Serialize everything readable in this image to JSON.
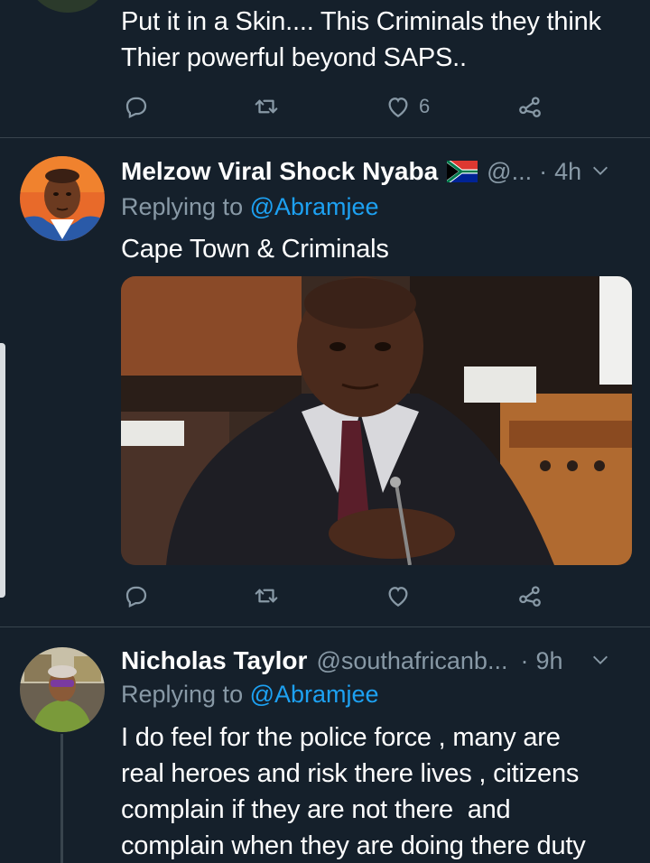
{
  "tweets": [
    {
      "text_lines": [
        "Put it in a Skin.... This Criminals they think",
        "Thier powerful beyond SAPS.."
      ],
      "actions": {
        "like_count": "6"
      }
    },
    {
      "name": "Melzow Viral Shock Nyaba",
      "handle": "@...",
      "time": "4h",
      "replying_prefix": "Replying to ",
      "replying_to": "@Abramjee",
      "text_lines": [
        "Cape Town & Criminals"
      ],
      "actions": {
        "like_count": ""
      }
    },
    {
      "name": "Nicholas Taylor",
      "handle": "@southafricanb...",
      "time": "9h",
      "replying_prefix": "Replying to ",
      "replying_to": "@Abramjee",
      "text_lines": [
        "I do feel for the police force , many are",
        "real heroes and risk there lives , citizens",
        "complain if they are not there  and",
        "complain when they are doing there duty"
      ]
    }
  ],
  "separator": "·",
  "colors": {
    "background": "#15202b",
    "divider": "#38444d",
    "secondary_text": "#8899a6",
    "link": "#1da1f2"
  },
  "icons": [
    "reply-icon",
    "retweet-icon",
    "like-icon",
    "share-icon",
    "chevron-down-icon",
    "south-africa-flag-icon"
  ]
}
